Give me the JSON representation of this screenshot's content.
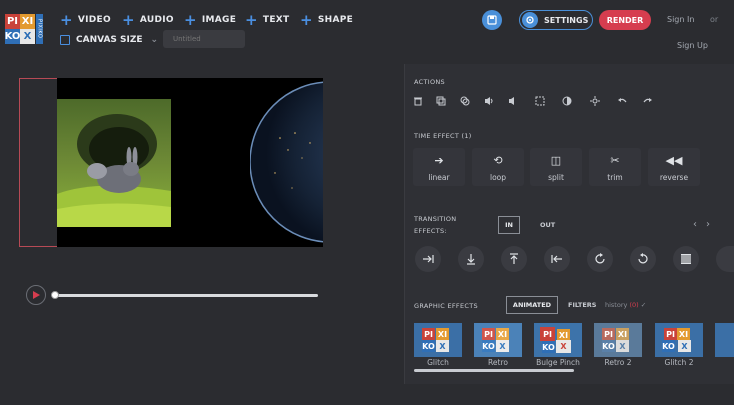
{
  "app": {
    "logo_letters": [
      "PI",
      "XI",
      "KO",
      "X"
    ],
    "logo_side_text": "PIXIKO",
    "brand_colors": {
      "red": "#c9433a",
      "orange": "#e39a2f",
      "blue": "#2f6fb6",
      "accent": "#4a90d9",
      "render": "#d63d4f"
    }
  },
  "menu": {
    "video": "VIDEO",
    "audio": "AUDIO",
    "image": "IMAGE",
    "text": "TEXT",
    "shape": "SHAPE",
    "canvas_size": "CANVAS SIZE",
    "project_title_placeholder": "Untitled"
  },
  "header": {
    "settings": "SETTINGS",
    "render": "RENDER",
    "sign_in": "Sign In",
    "or": "or",
    "sign_up": "Sign Up"
  },
  "panel": {
    "actions_label": "ACTIONS",
    "actions": [
      "trash-icon",
      "duplicate-icon",
      "copy-icon",
      "volume-up-icon",
      "volume-down-icon",
      "crop-icon",
      "contrast-icon",
      "brightness-icon",
      "undo-icon",
      "redo-icon"
    ],
    "time_effect_label": "TIME EFFECT (1)",
    "time_effects": [
      {
        "label": "linear",
        "icon": "arrow-right-icon"
      },
      {
        "label": "loop",
        "icon": "loop-icon"
      },
      {
        "label": "split",
        "icon": "split-icon"
      },
      {
        "label": "trim",
        "icon": "scissors-icon"
      },
      {
        "label": "reverse",
        "icon": "rewind-icon"
      }
    ],
    "transition_label_1": "TRANSITION",
    "transition_label_2": "EFFECTS:",
    "tab_in": "IN",
    "tab_out": "OUT",
    "transitions": [
      "slide-right-icon",
      "slide-down-icon",
      "slide-up-icon",
      "slide-left-icon",
      "rotate-cw-icon",
      "rotate-ccw-icon",
      "blinds-icon"
    ],
    "graphic_effects_label": "GRAPHIC EFFECTS",
    "tab_animated": "ANIMATED",
    "tab_filters": "FILTERS",
    "history_text": "history",
    "history_count": "(0)",
    "graphic_effects": [
      "Glitch",
      "Retro",
      "Bulge Pinch",
      "Retro 2",
      "Glitch 2"
    ]
  },
  "player": {
    "progress": 0
  }
}
